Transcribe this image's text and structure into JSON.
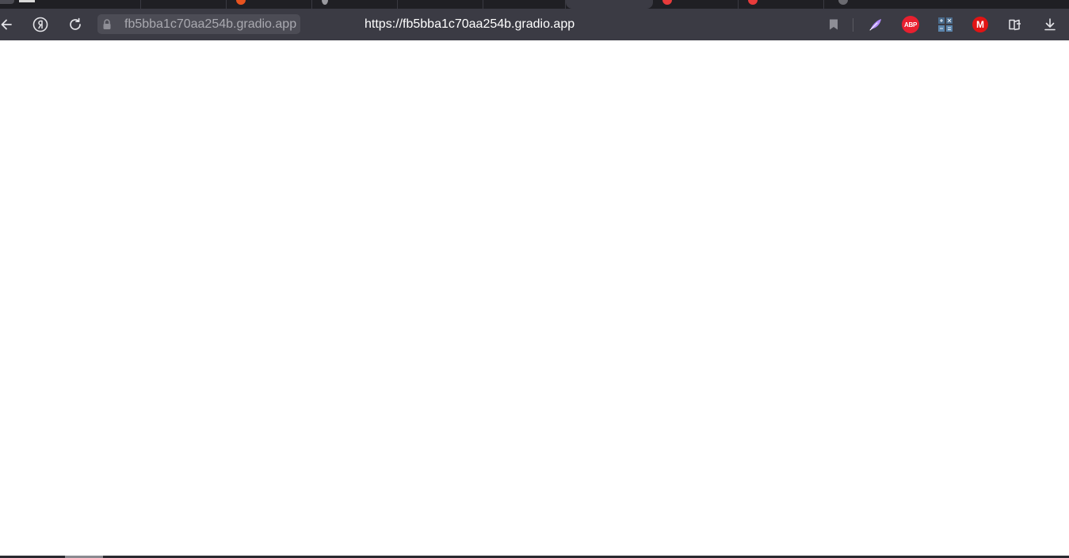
{
  "toolbar": {
    "host_chip": "fb5bba1c70aa254b.gradio.app",
    "page_title": "https://fb5bba1c70aa254b.gradio.app"
  },
  "icons": {
    "back": "arrow-left-icon",
    "yandex": "yandex-logo-icon",
    "reload": "reload-icon",
    "lock": "lock-icon",
    "bookmark": "bookmark-icon",
    "feather": "feather-icon",
    "abp": "adblock-plus-icon",
    "calculator": "calculator-icon",
    "mega": "mega-icon",
    "collections": "collections-icon",
    "downloads": "download-icon"
  },
  "extensions": {
    "abp_label": "ABP",
    "mega_label": "M"
  },
  "colors": {
    "toolbar_bg": "#3b3b44",
    "tabstrip_bg": "#1f1f24",
    "abp_red": "#e8202f",
    "mega_red": "#e11414",
    "feather_purple": "#b48cff"
  }
}
